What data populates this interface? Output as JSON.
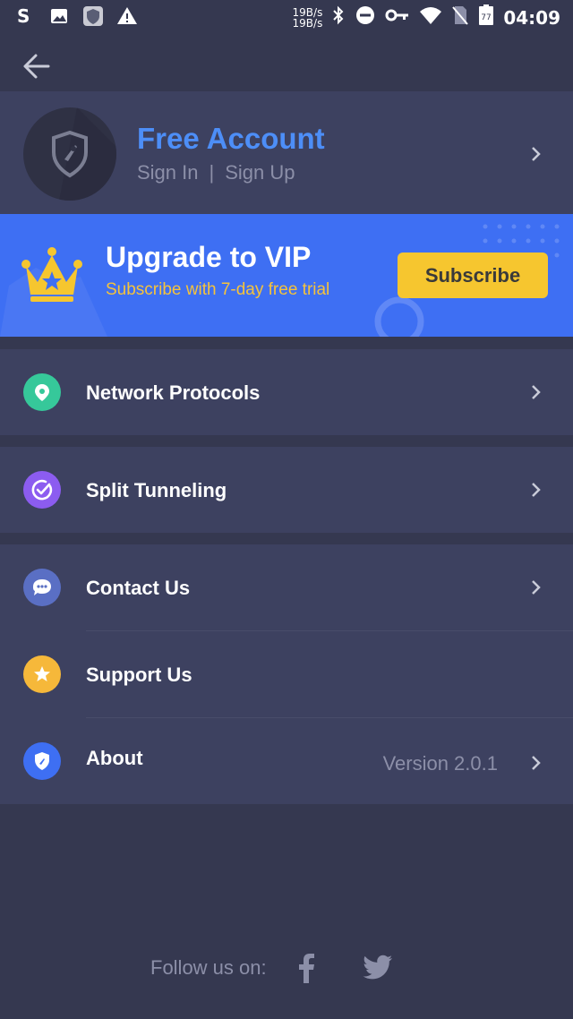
{
  "status_bar": {
    "net_up": "19B/s",
    "net_down": "19B/s",
    "battery": "77",
    "time": "04:09"
  },
  "account": {
    "title": "Free Account",
    "sign_in": "Sign In",
    "separator": "|",
    "sign_up": "Sign Up"
  },
  "vip": {
    "title": "Upgrade to VIP",
    "subtitle": "Subscribe with 7-day free trial",
    "button": "Subscribe"
  },
  "menu": {
    "network_protocols": "Network Protocols",
    "split_tunneling": "Split Tunneling",
    "contact_us": "Contact Us",
    "support_us": "Support Us",
    "about": "About",
    "version": "Version 2.0.1"
  },
  "footer": {
    "follow_label": "Follow us on:"
  },
  "colors": {
    "background": "#353850",
    "card": "#3d4160",
    "accent_blue": "#4d8ef7",
    "vip_banner": "#3e6ff3",
    "subscribe_yellow": "#f6c62f"
  },
  "icons": [
    "back-arrow-icon",
    "shield-rocket-icon",
    "crown-icon",
    "location-pin-icon",
    "check-circle-icon",
    "chat-bubble-icon",
    "star-icon",
    "shield-icon",
    "chevron-right-icon",
    "facebook-icon",
    "twitter-icon"
  ]
}
